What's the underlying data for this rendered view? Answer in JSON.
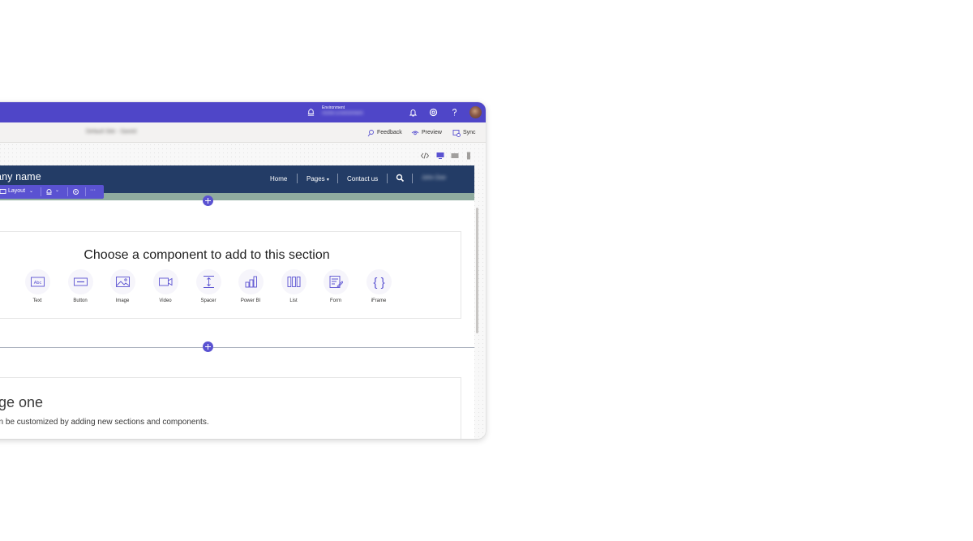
{
  "topbar": {
    "environment_label": "Environment",
    "environment_value": "Acme Environment",
    "accent": "#4f46c8"
  },
  "commandbar": {
    "site_title": "Default Site - Saved",
    "feedback_label": "Feedback",
    "preview_label": "Preview",
    "sync_label": "Sync"
  },
  "site": {
    "company_name": "pany name",
    "nav": {
      "home": "Home",
      "pages": "Pages",
      "contact": "Contact us",
      "user": "John Doe"
    },
    "header_color": "#233c66"
  },
  "layout_toolbar": {
    "layout_label": "Layout",
    "more_label": "···"
  },
  "component_section": {
    "title": "Choose a component to add to this section",
    "components": [
      {
        "label": "Text",
        "icon": "text-icon"
      },
      {
        "label": "Button",
        "icon": "button-icon"
      },
      {
        "label": "Image",
        "icon": "image-icon"
      },
      {
        "label": "Video",
        "icon": "video-icon"
      },
      {
        "label": "Spacer",
        "icon": "spacer-icon"
      },
      {
        "label": "Power BI",
        "icon": "power-bi-icon"
      },
      {
        "label": "List",
        "icon": "list-icon"
      },
      {
        "label": "Form",
        "icon": "form-icon"
      },
      {
        "label": "iFrame",
        "icon": "iframe-icon"
      }
    ]
  },
  "page_section": {
    "title": "age one",
    "subtitle": "can be customized by adding new sections and components."
  }
}
